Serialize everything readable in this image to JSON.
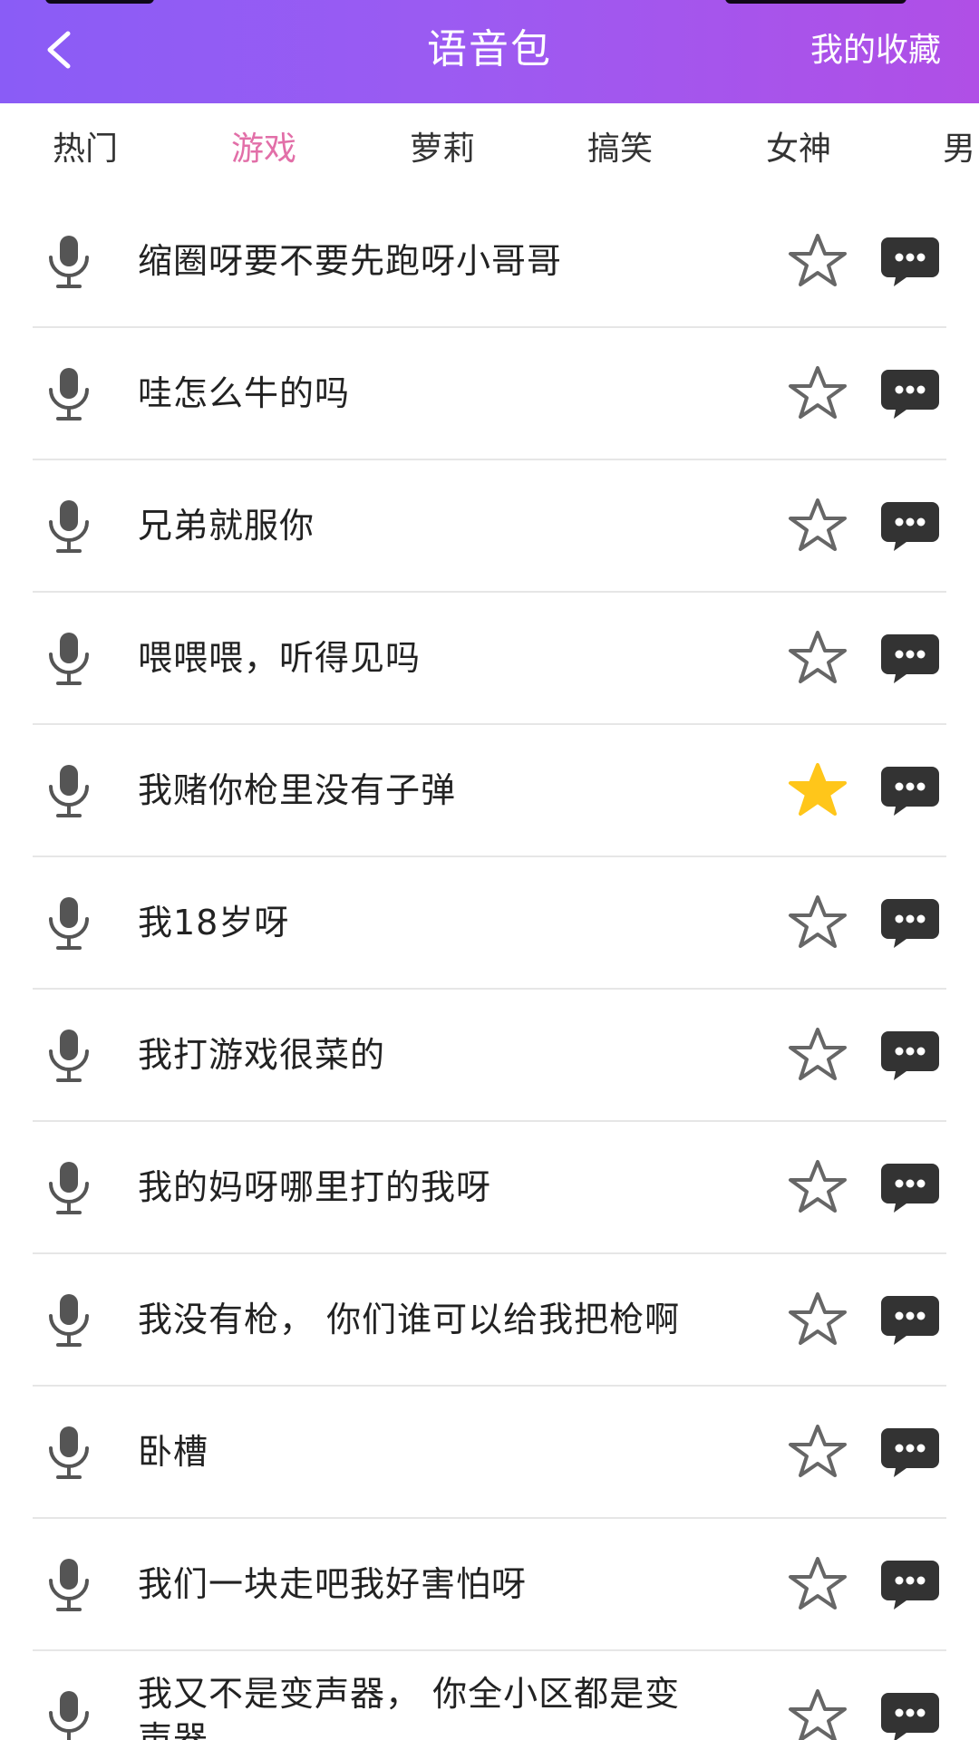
{
  "header": {
    "title": "语音包",
    "favorites_label": "我的收藏",
    "back_icon": "chevron-left-icon",
    "gradient_start": "#8a5cf6",
    "gradient_end": "#b04fe6"
  },
  "tabs": [
    {
      "label": "热门",
      "active": false
    },
    {
      "label": "游戏",
      "active": true
    },
    {
      "label": "萝莉",
      "active": false
    },
    {
      "label": "搞笑",
      "active": false
    },
    {
      "label": "女神",
      "active": false
    },
    {
      "label": "男",
      "active": false
    }
  ],
  "colors": {
    "active_tab": "#e26fa8",
    "favorited_star": "#ffc61a",
    "icon_gray": "#555555",
    "chat_bubble": "#333333"
  },
  "items": [
    {
      "text": "缩圈呀要不要先跑呀小哥哥",
      "favorited": false
    },
    {
      "text": "哇怎么牛的吗",
      "favorited": false
    },
    {
      "text": "兄弟就服你",
      "favorited": false
    },
    {
      "text": "喂喂喂，听得见吗",
      "favorited": false
    },
    {
      "text": "我赌你枪里没有子弹",
      "favorited": true
    },
    {
      "text": "我18岁呀",
      "favorited": false
    },
    {
      "text": "我打游戏很菜的",
      "favorited": false
    },
    {
      "text": "我的妈呀哪里打的我呀",
      "favorited": false
    },
    {
      "text": "我没有枪， 你们谁可以给我把枪啊",
      "favorited": false
    },
    {
      "text": "卧槽",
      "favorited": false
    },
    {
      "text": "我们一块走吧我好害怕呀",
      "favorited": false
    },
    {
      "text": "我又不是变声器， 你全小区都是变声器",
      "favorited": false
    }
  ]
}
